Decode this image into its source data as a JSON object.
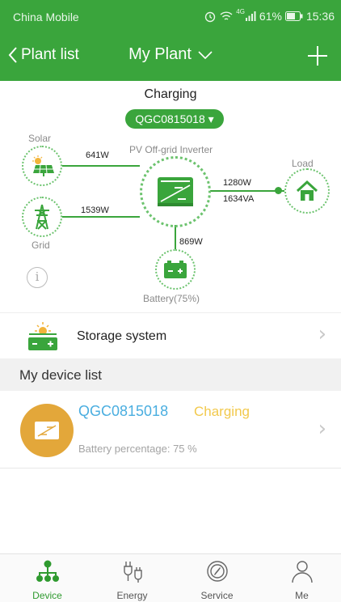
{
  "status_bar": {
    "carrier": "China Mobile",
    "indicators": "4G",
    "battery": "61%",
    "time": "15:36"
  },
  "header": {
    "back_label": "Plant list",
    "title": "My Plant",
    "add_icon": "plus-icon"
  },
  "flow": {
    "state": "Charging",
    "device_selector": "QGC0815018 ▾",
    "inverter_label": "PV Off-grid Inverter",
    "solar_label": "Solar",
    "solar_power": "641W",
    "grid_label": "Grid",
    "grid_power": "1539W",
    "load_label": "Load",
    "load_power": "1280W",
    "load_apparent": "1634VA",
    "battery_power": "869W",
    "battery_label": "Battery(75%)",
    "info_icon": "info-icon"
  },
  "storage": {
    "label": "Storage system"
  },
  "device_list": {
    "title": "My device list",
    "items": [
      {
        "serial": "QGC0815018",
        "status": "Charging",
        "battery": "Battery percentage: 75 %"
      }
    ]
  },
  "tabs": [
    {
      "label": "Device",
      "icon": "device-tree-icon",
      "active": true
    },
    {
      "label": "Energy",
      "icon": "energy-plug-icon",
      "active": false
    },
    {
      "label": "Service",
      "icon": "service-compass-icon",
      "active": false
    },
    {
      "label": "Me",
      "icon": "person-icon",
      "active": false
    }
  ],
  "colors": {
    "primary": "#3aa53c",
    "accent_blue": "#4aaee0",
    "status_yellow": "#f2c94c",
    "avatar_orange": "#e3a73a"
  }
}
